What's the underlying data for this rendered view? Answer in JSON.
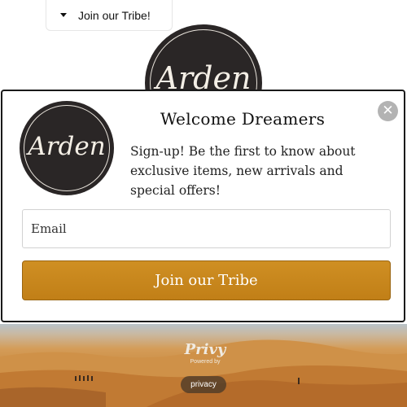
{
  "tab": {
    "label": "Join our Tribe!",
    "icon": "caret-down-icon"
  },
  "brand": {
    "logo_text": "Arden"
  },
  "modal": {
    "title": "Welcome Dreamers",
    "body": "Sign-up! Be the first to know about exclusive items, new arrivals and special offers!",
    "close_icon": "close-icon",
    "email_placeholder": "Email",
    "email_value": "",
    "submit_label": "Join our Tribe",
    "button_color": "#c58520"
  },
  "footer": {
    "privy_logo": "Privy",
    "powered_by": "Powered by",
    "privacy_label": "privacy"
  }
}
